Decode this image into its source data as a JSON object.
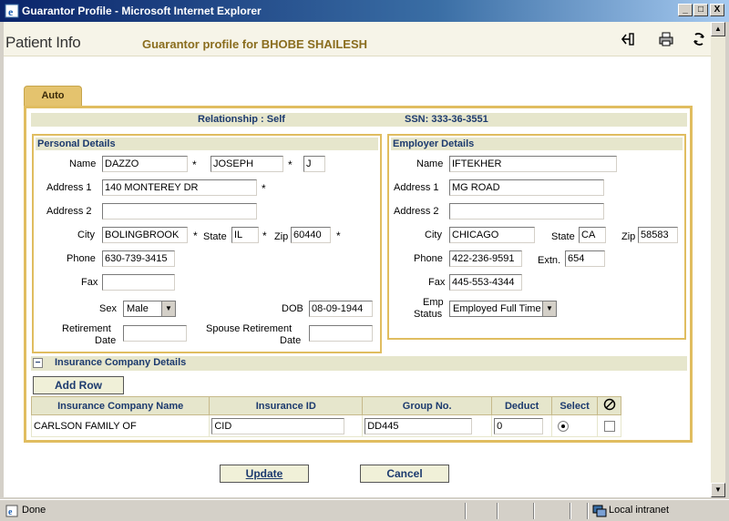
{
  "window": {
    "title": "Guarantor Profile - Microsoft Internet Explorer",
    "buttons": {
      "minimize": "_",
      "maximize": "□",
      "close": "X"
    }
  },
  "header": {
    "app_title": "Patient Info",
    "subtitle": "Guarantor profile for BHOBE SHAILESH",
    "icons": [
      "back-icon",
      "print-icon",
      "refresh-icon"
    ]
  },
  "tab": {
    "label": "Auto"
  },
  "relationship": {
    "label": "Relationship : Self",
    "ssn": "SSN: 333-36-3551"
  },
  "personal": {
    "heading": "Personal Details",
    "name_label": "Name",
    "last_name": "DAZZO",
    "first_name": "JOSEPH",
    "middle_initial": "J",
    "address1_label": "Address 1",
    "address1": "140 MONTEREY DR",
    "address2_label": "Address 2",
    "address2": "",
    "city_label": "City",
    "city": "BOLINGBROOK",
    "state_label": "State",
    "state": "IL",
    "zip_label": "Zip",
    "zip": "60440",
    "phone_label": "Phone",
    "phone": "630-739-3415",
    "fax_label": "Fax",
    "fax": "",
    "sex_label": "Sex",
    "sex": "Male",
    "dob_label": "DOB",
    "dob": "08-09-1944",
    "retirement_label_1": "Retirement",
    "retirement_label_2": "Date",
    "retirement_date": "",
    "spouse_label_1": "Spouse Retirement",
    "spouse_label_2": "Date",
    "spouse_retirement_date": "",
    "required_mark": "*"
  },
  "employer": {
    "heading": "Employer Details",
    "name_label": "Name",
    "name": "IFTEKHER",
    "address1_label": "Address 1",
    "address1": "MG ROAD",
    "address2_label": "Address 2",
    "address2": "",
    "city_label": "City",
    "city": "CHICAGO",
    "state_label": "State",
    "state": "CA",
    "zip_label": "Zip",
    "zip": "58583",
    "phone_label": "Phone",
    "phone": "422-236-9591",
    "extn_label": "Extn.",
    "extn": "654",
    "fax_label": "Fax",
    "fax": "445-553-4344",
    "emp_status_label_1": "Emp",
    "emp_status_label_2": "Status",
    "emp_status": "Employed Full Time"
  },
  "insurance": {
    "heading": "Insurance Company Details",
    "collapse_glyph": "−",
    "add_row_label": "Add Row",
    "columns": [
      "Insurance Company Name",
      "Insurance ID",
      "Group No.",
      "Deduct",
      "Select"
    ],
    "rows": [
      {
        "company": "CARLSON FAMILY OF",
        "insurance_id": "CID",
        "group_no": "DD445",
        "deduct": "0"
      }
    ]
  },
  "actions": {
    "update_label": "Update",
    "cancel_label": "Cancel"
  },
  "statusbar": {
    "status": "Done",
    "zone": "Local intranet"
  },
  "colors": {
    "accent_border": "#e0bd60",
    "section_header_bg": "#e6e6cc",
    "heading_text": "#1c3a6e",
    "title_bar": "#0a246a"
  }
}
